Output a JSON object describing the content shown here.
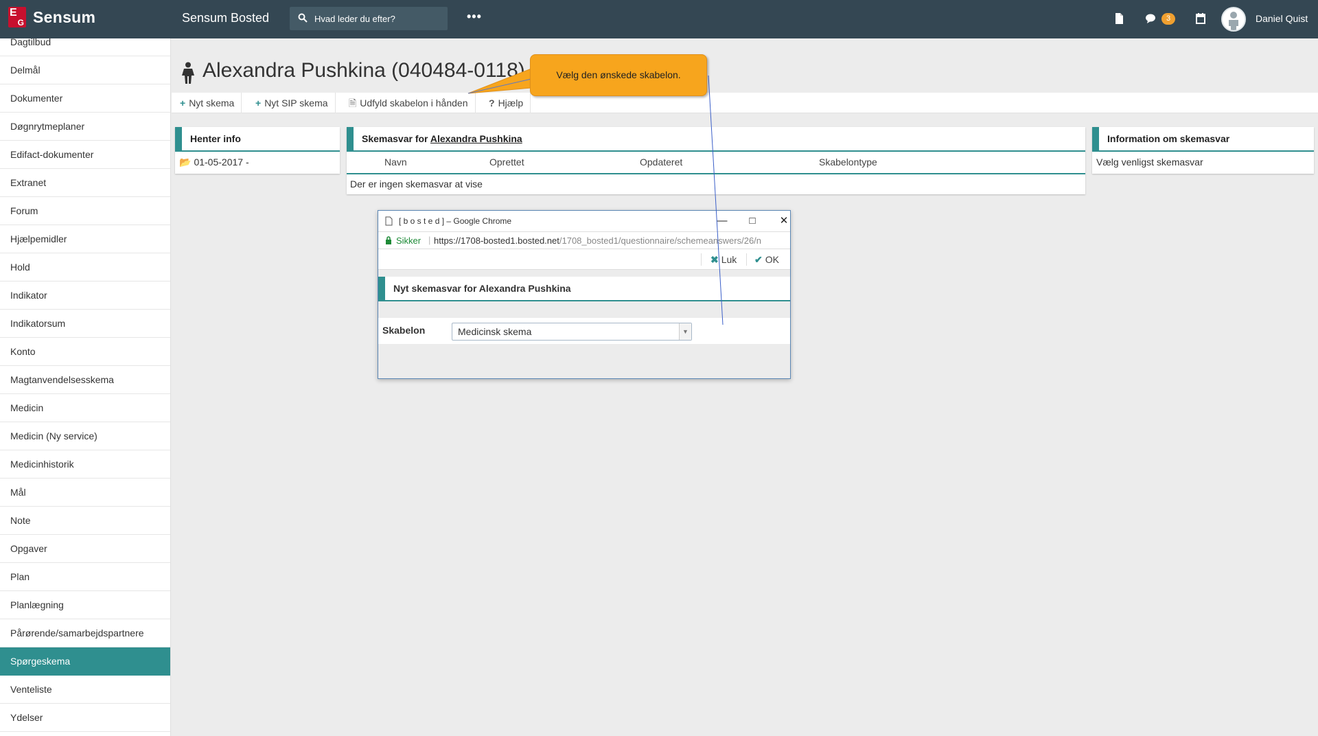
{
  "topbar": {
    "logo_text": "Sensum",
    "app_title": "Sensum Bosted",
    "search_placeholder": "Hvad leder du efter?",
    "more_label": "•••",
    "messages_badge": "3",
    "username": "Daniel Quist"
  },
  "sidebar": {
    "items": [
      "Dagtilbud",
      "Delmål",
      "Dokumenter",
      "Døgnrytmeplaner",
      "Edifact-dokumenter",
      "Extranet",
      "Forum",
      "Hjælpemidler",
      "Hold",
      "Indikator",
      "Indikatorsum",
      "Konto",
      "Magtanvendelsesskema",
      "Medicin",
      "Medicin (Ny service)",
      "Medicinhistorik",
      "Mål",
      "Note",
      "Opgaver",
      "Plan",
      "Planlægning",
      "Pårørende/samarbejdspartnere",
      "Spørgeskema",
      "Venteliste",
      "Ydelser"
    ],
    "active": "Spørgeskema"
  },
  "page": {
    "title": "Alexandra Pushkina (040484-0118)"
  },
  "toolbar": {
    "new_form": "Nyt skema",
    "new_sip_form": "Nyt SIP skema",
    "fill_by_hand": "Udfyld skabelon i hånden",
    "help": "Hjælp"
  },
  "panels": {
    "info": {
      "title": "Henter info",
      "date": "01-05-2017 -"
    },
    "answers": {
      "title_prefix": "Skemasvar for",
      "title_name": "Alexandra Pushkina",
      "columns": [
        "Navn",
        "Oprettet",
        "Opdateret",
        "Skabelontype"
      ],
      "empty_text": "Der er ingen skemasvar at vise"
    },
    "answer_info": {
      "title": "Information om skemasvar",
      "text": "Vælg venligst skemasvar"
    }
  },
  "popup": {
    "window_title": "[ b o s t e d ] – Google Chrome",
    "secure_label": "Sikker",
    "url_scheme": "https://",
    "url_host": "1708-bosted1.bosted.net",
    "url_path": "/1708_bosted1/questionnaire/schemeanswers/26/n",
    "close_label": "Luk",
    "ok_label": "OK",
    "heading": "Nyt skemasvar for Alexandra Pushkina",
    "template_label": "Skabelon",
    "template_value": "Medicinsk skema"
  },
  "callout": {
    "text": "Vælg den ønskede skabelon."
  },
  "colors": {
    "topbar": "#344753",
    "accent": "#2f8f8f",
    "badge": "#f0a030",
    "callout": "#f7a51d",
    "secure": "#1d8a37"
  }
}
